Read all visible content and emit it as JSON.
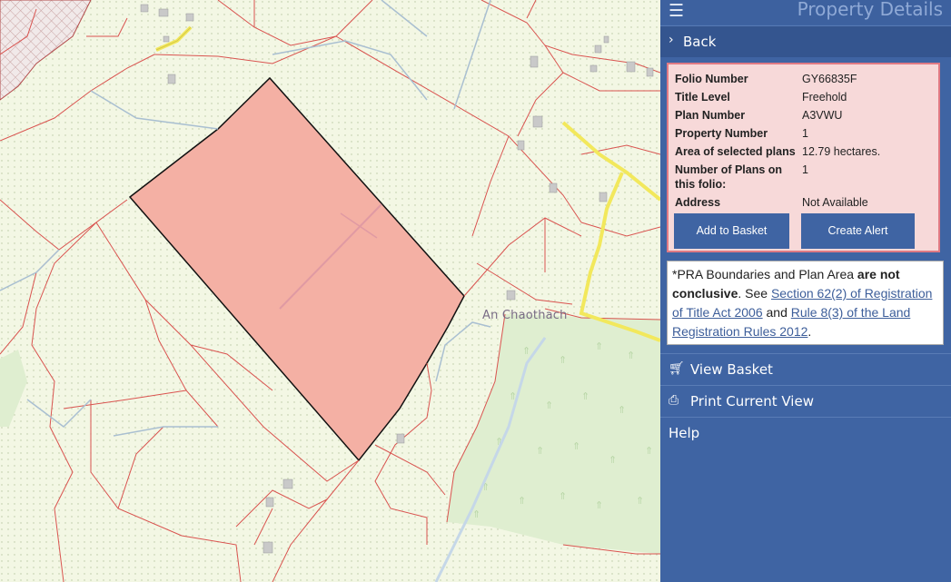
{
  "panel": {
    "title": "Property Details",
    "menu_icon": "hamburger-icon",
    "back_label": "Back",
    "back_icon": "chevron-right-icon"
  },
  "details": {
    "rows": [
      {
        "label": "Folio Number",
        "value": "GY66835F"
      },
      {
        "label": "Title Level",
        "value": "Freehold"
      },
      {
        "label": "Plan Number",
        "value": "A3VWU"
      },
      {
        "label": "Property Number",
        "value": "1"
      },
      {
        "label": "Area of selected plans",
        "value": "12.79 hectares."
      },
      {
        "label": "Number of Plans on this folio:",
        "value": "1"
      },
      {
        "label": "Address",
        "value": "Not Available"
      }
    ],
    "add_to_basket": "Add to Basket",
    "create_alert": "Create Alert"
  },
  "note": {
    "prefix": "*PRA Boundaries and Plan Area ",
    "bold": "are not conclusive",
    "see": ". See ",
    "link1": "Section 62(2) of Registration of Title Act 2006",
    "and": " and ",
    "link2": "Rule 8(3) of the Land Registration Rules 2012",
    "end": "."
  },
  "menu": {
    "view_basket": "View Basket",
    "view_basket_icon": "cart-icon",
    "print_view": "Print Current View",
    "print_icon": "printer-icon",
    "help": "Help"
  },
  "map": {
    "place_label": "An Chaothach",
    "selected_parcel_color": "#f4b0a4",
    "boundary_color": "#d9534f",
    "road_color": "#f2e85c",
    "forest_color": "#dfeed0"
  },
  "colors": {
    "panel_bg": "#3f64a3",
    "details_bg": "#f7d9d9",
    "details_border": "#e07a84"
  }
}
